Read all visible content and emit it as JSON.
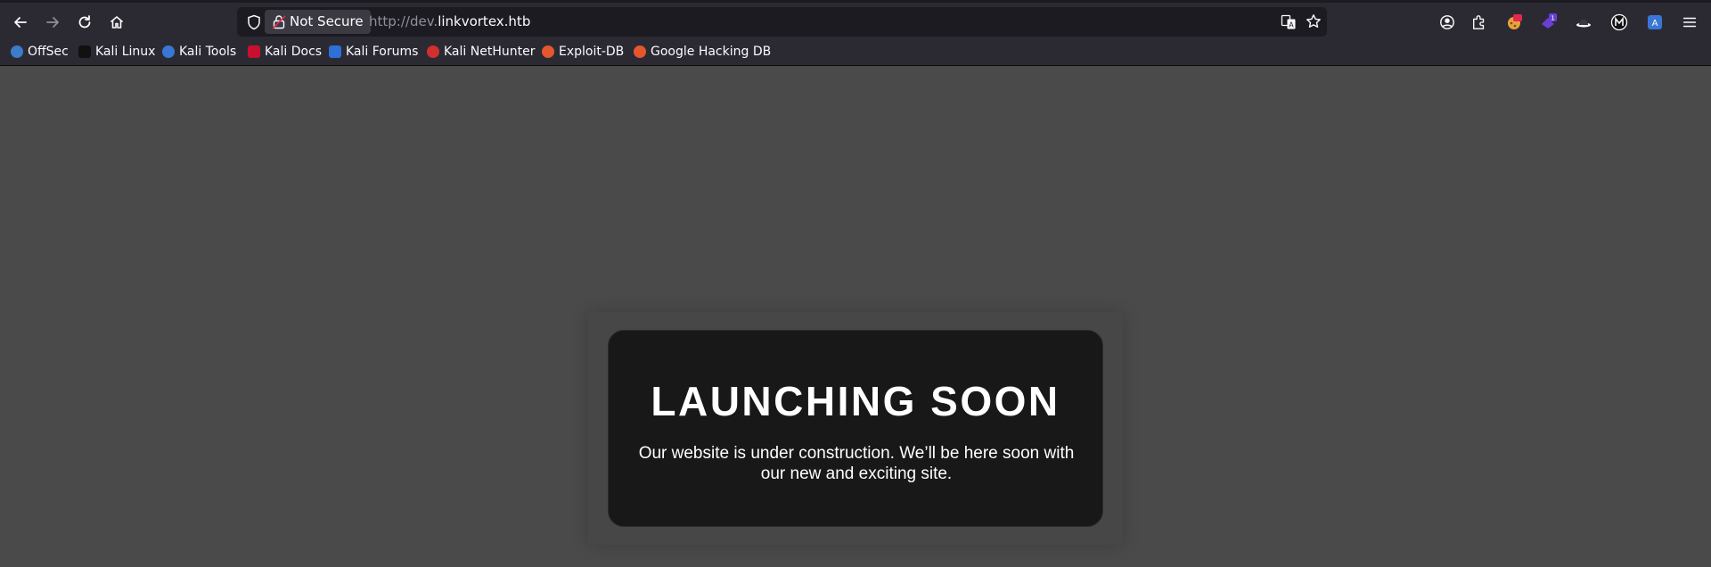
{
  "browser": {
    "url_security_label": "Not Secure",
    "url_prefix": "http://dev.",
    "url_domain": "linkvortex.htb"
  },
  "bookmarks": [
    {
      "label": "OffSec",
      "icon": "offsec-icon",
      "color": "#3c7cc9"
    },
    {
      "label": "Kali Linux",
      "icon": "kali-dragon-icon",
      "color": "#111111"
    },
    {
      "label": "Kali Tools",
      "icon": "kali-tools-icon",
      "color": "#3a76d6"
    },
    {
      "label": "Kali Docs",
      "icon": "kali-docs-icon",
      "color": "#c8102e"
    },
    {
      "label": "Kali Forums",
      "icon": "kali-forums-icon",
      "color": "#2e6fd8"
    },
    {
      "label": "Kali NetHunter",
      "icon": "kali-nethunter-icon",
      "color": "#d22f2f"
    },
    {
      "label": "Exploit-DB",
      "icon": "exploit-db-icon",
      "color": "#e4572e"
    },
    {
      "label": "Google Hacking DB",
      "icon": "ghdb-icon",
      "color": "#e4572e"
    }
  ],
  "page": {
    "headline": "LAUNCHING SOON",
    "message": "Our website is under construction. We’ll be here soon with our new and exciting site."
  }
}
